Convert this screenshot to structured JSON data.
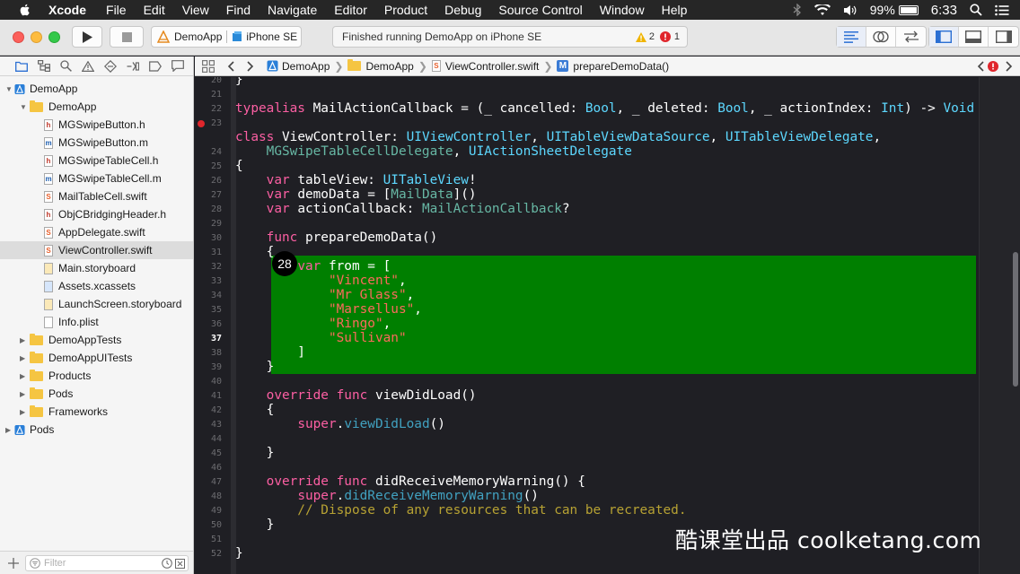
{
  "menubar": {
    "app_name": "Xcode",
    "menus": [
      "File",
      "Edit",
      "View",
      "Find",
      "Navigate",
      "Editor",
      "Product",
      "Debug",
      "Source Control",
      "Window",
      "Help"
    ],
    "battery": "99%",
    "clock": "6:33"
  },
  "toolbar": {
    "scheme": "DemoApp",
    "destination": "iPhone SE",
    "activity_status": "Finished running DemoApp on iPhone SE",
    "warning_count": "2",
    "error_count": "1"
  },
  "navigator": {
    "filter_placeholder": "Filter",
    "tree": [
      {
        "label": "DemoApp",
        "depth": 0,
        "kind": "project",
        "expanded": true
      },
      {
        "label": "DemoApp",
        "depth": 1,
        "kind": "folder",
        "expanded": true
      },
      {
        "label": "MGSwipeButton.h",
        "depth": 2,
        "kind": "h"
      },
      {
        "label": "MGSwipeButton.m",
        "depth": 2,
        "kind": "m"
      },
      {
        "label": "MGSwipeTableCell.h",
        "depth": 2,
        "kind": "h"
      },
      {
        "label": "MGSwipeTableCell.m",
        "depth": 2,
        "kind": "m"
      },
      {
        "label": "MailTableCell.swift",
        "depth": 2,
        "kind": "swift"
      },
      {
        "label": "ObjCBridgingHeader.h",
        "depth": 2,
        "kind": "h"
      },
      {
        "label": "AppDelegate.swift",
        "depth": 2,
        "kind": "swift"
      },
      {
        "label": "ViewController.swift",
        "depth": 2,
        "kind": "swift",
        "selected": true
      },
      {
        "label": "Main.storyboard",
        "depth": 2,
        "kind": "storyboard"
      },
      {
        "label": "Assets.xcassets",
        "depth": 2,
        "kind": "assets"
      },
      {
        "label": "LaunchScreen.storyboard",
        "depth": 2,
        "kind": "storyboard"
      },
      {
        "label": "Info.plist",
        "depth": 2,
        "kind": "plist"
      },
      {
        "label": "DemoAppTests",
        "depth": 1,
        "kind": "folder",
        "expanded": false
      },
      {
        "label": "DemoAppUITests",
        "depth": 1,
        "kind": "folder",
        "expanded": false
      },
      {
        "label": "Products",
        "depth": 1,
        "kind": "folder",
        "expanded": false
      },
      {
        "label": "Pods",
        "depth": 1,
        "kind": "folder",
        "expanded": false
      },
      {
        "label": "Frameworks",
        "depth": 1,
        "kind": "folder",
        "expanded": false
      },
      {
        "label": "Pods",
        "depth": 0,
        "kind": "project",
        "expanded": false
      }
    ]
  },
  "jumpbar": {
    "crumbs": [
      "DemoApp",
      "DemoApp",
      "ViewController.swift",
      "prepareDemoData()"
    ]
  },
  "editor": {
    "counter_badge": "28",
    "line_numbers": [
      "20",
      "21",
      "22",
      "23",
      "",
      "24",
      "25",
      "26",
      "27",
      "28",
      "29",
      "30",
      "31",
      "32",
      "33",
      "34",
      "35",
      "36",
      "37",
      "38",
      "39",
      "40",
      "41",
      "42",
      "43",
      "44",
      "45",
      "46",
      "47",
      "48",
      "49",
      "50",
      "51",
      "52"
    ],
    "current_line": "37",
    "error_line": "23",
    "code_lines": [
      "}",
      "",
      "typealias MailActionCallback = (_ cancelled: Bool, _ deleted: Bool, _ actionIndex: Int) -> Void",
      "",
      "class ViewController: UIViewController, UITableViewDataSource, UITableViewDelegate,",
      "    MGSwipeTableCellDelegate, UIActionSheetDelegate",
      "{",
      "    var tableView: UITableView!",
      "    var demoData = [MailData]()",
      "    var actionCallback: MailActionCallback?",
      "",
      "    func prepareDemoData()",
      "    {",
      "        var from = [",
      "            \"Vincent\",",
      "            \"Mr Glass\",",
      "            \"Marsellus\",",
      "            \"Ringo\",",
      "            \"Sullivan\"",
      "        ]",
      "    }",
      "",
      "    override func viewDidLoad()",
      "    {",
      "        super.viewDidLoad()",
      "",
      "    }",
      "",
      "    override func didReceiveMemoryWarning() {",
      "        super.didReceiveMemoryWarning()",
      "        // Dispose of any resources that can be recreated.",
      "    }",
      "",
      "}",
      ""
    ]
  },
  "watermark": "酷课堂出品 coolketang.com"
}
